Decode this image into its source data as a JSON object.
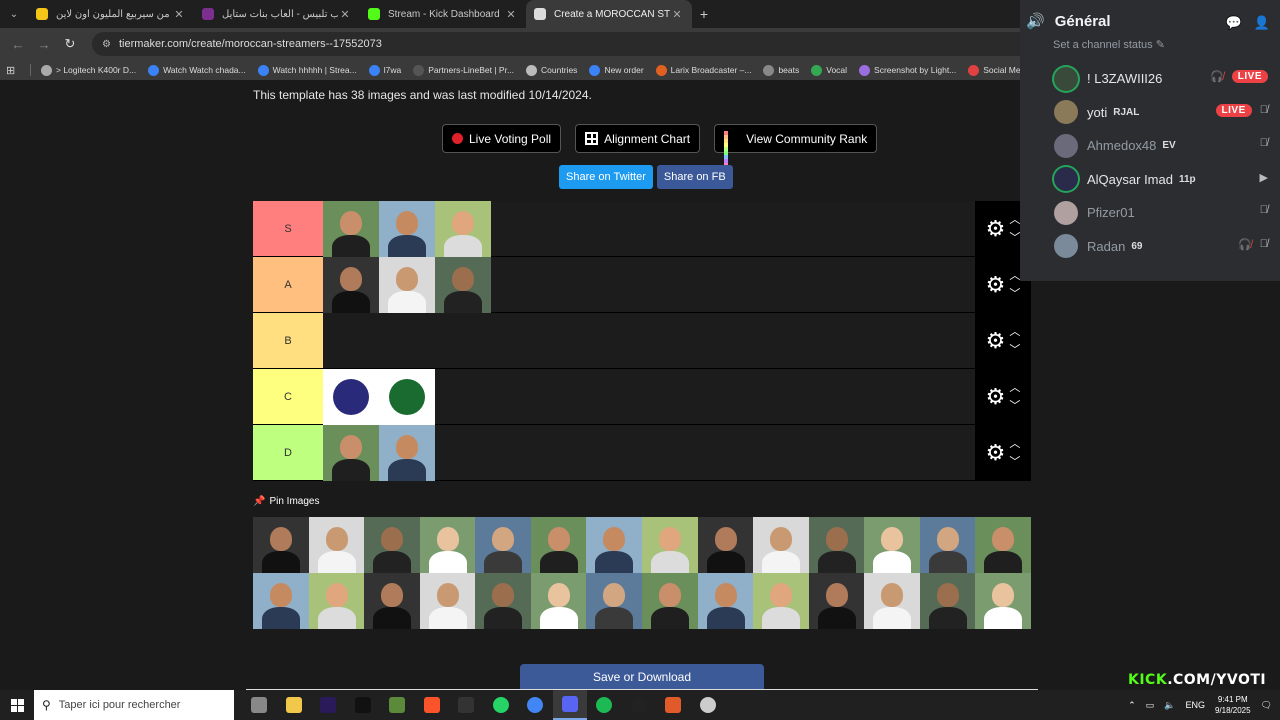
{
  "browser": {
    "tabs": [
      {
        "label": "لعبة من سيربيع المليون اون لاين ..",
        "close": "✕",
        "favicon_color": "#f5c518",
        "active": false
      },
      {
        "label": "العاب تلبيس - العاب بنات ستايل",
        "close": "✕",
        "favicon_color": "#7b2f8f",
        "active": false
      },
      {
        "label": "Stream - Kick Dashboard",
        "close": "✕",
        "favicon_color": "#53fc18",
        "active": false
      },
      {
        "label": "Create a MOROCCAN STREAMER",
        "close": "✕",
        "favicon_color": "#dddddd",
        "active": true
      }
    ],
    "new_tab": "+",
    "url": "tiermaker.com/create/moroccan-streamers--17552073",
    "bookmarks": [
      {
        "label": "> Logitech K400r D...",
        "color": "#aaaaaa"
      },
      {
        "label": "Watch Watch chada...",
        "color": "#3b82f6"
      },
      {
        "label": "Watch hhhhh | Strea...",
        "color": "#3b82f6"
      },
      {
        "label": "l7wa",
        "color": "#3b82f6"
      },
      {
        "label": "Partners-LineBet | Pr...",
        "color": "#555555"
      },
      {
        "label": "Countries",
        "color": "#bbbbbb"
      },
      {
        "label": "New order",
        "color": "#3b82f6"
      },
      {
        "label": "Larix Broadcaster –...",
        "color": "#e06020"
      },
      {
        "label": "beats",
        "color": "#888888"
      },
      {
        "label": "Vocal",
        "color": "#34a853"
      },
      {
        "label": "Screenshot by Light...",
        "color": "#9a6ee0"
      },
      {
        "label": "Social Media Pa",
        "color": "#e04040"
      }
    ]
  },
  "page": {
    "description": "This template has 38 images and was last modified 10/14/2024.",
    "buttons": {
      "live_poll": "Live Voting Poll",
      "alignment": "Alignment Chart",
      "community": "View Community Rank"
    },
    "share": {
      "twitter": "Share on Twitter",
      "twitter_color": "#1d9bf0",
      "fb": "Share on FB",
      "fb_color": "#3b5998"
    },
    "tiers": [
      {
        "label": "S",
        "color": "#ff7f7f",
        "items": 3
      },
      {
        "label": "A",
        "color": "#ffbf7f",
        "items": 3
      },
      {
        "label": "B",
        "color": "#ffdf7f",
        "items": 0
      },
      {
        "label": "C",
        "color": "#ffff7f",
        "items": 2
      },
      {
        "label": "D",
        "color": "#bfff7f",
        "items": 2
      }
    ],
    "pin_title": "Pin Images",
    "save_label": "Save or Download"
  },
  "discord": {
    "channel": "Général",
    "status": "Set a channel status",
    "users": [
      {
        "name": "! L3ZAWIII26",
        "tag": "",
        "live": "LIVE",
        "muted": false,
        "speaking": true
      },
      {
        "name": "yoti",
        "tag": "RJAL",
        "live": "LIVE",
        "muted": true,
        "speaking": false
      },
      {
        "name": "Ahmedox48",
        "tag": "EV",
        "live": "",
        "muted": true,
        "speaking": false
      },
      {
        "name": "AlQaysar Imad",
        "tag": "11p",
        "live": "",
        "muted": false,
        "speaking": true
      },
      {
        "name": "Pfizer01",
        "tag": "",
        "live": "",
        "muted": true,
        "speaking": false
      },
      {
        "name": "Radan",
        "tag": "69",
        "live": "",
        "muted": true,
        "speaking": false
      }
    ]
  },
  "watermark": {
    "brand": "KICK",
    "handle": ".COM/YVOTI"
  },
  "taskbar": {
    "search_placeholder": "Taper ici pour rechercher",
    "lang": "ENG",
    "time": "9:41 PM",
    "date": "9/18/2025"
  }
}
